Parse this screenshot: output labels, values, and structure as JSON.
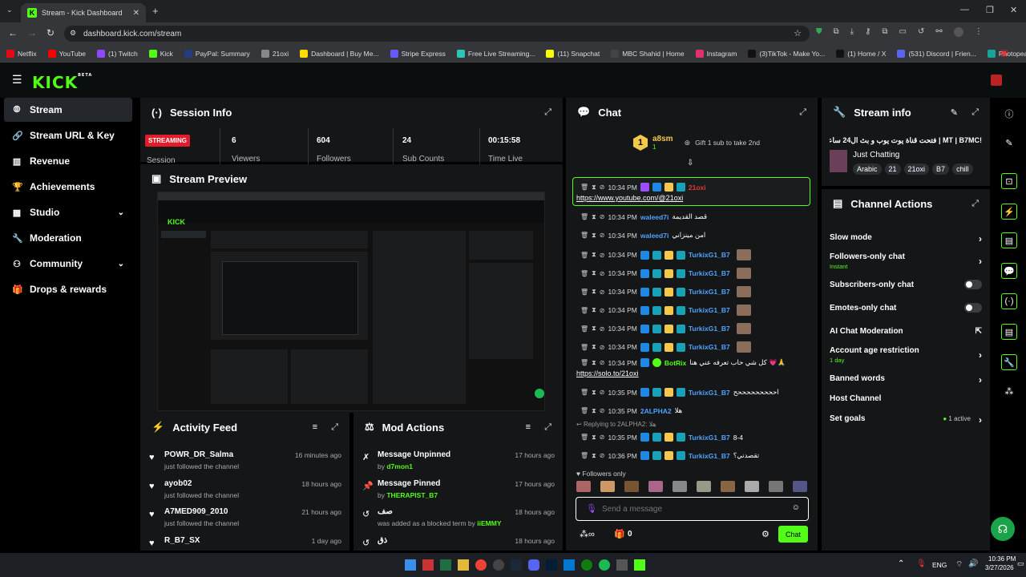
{
  "browser": {
    "tab_title": "Stream - Kick Dashboard",
    "url": "dashboard.kick.com/stream",
    "bookmarks": [
      {
        "label": "Netflix",
        "color": "#e50914"
      },
      {
        "label": "YouTube",
        "color": "#ff0000"
      },
      {
        "label": "(1) Twitch",
        "color": "#9146ff"
      },
      {
        "label": "Kick",
        "color": "#53fc18"
      },
      {
        "label": "PayPal: Summary",
        "color": "#253b80"
      },
      {
        "label": "21oxi",
        "color": "#888888"
      },
      {
        "label": "Dashboard | Buy Me...",
        "color": "#ffdd00"
      },
      {
        "label": "Stripe Express",
        "color": "#635bff"
      },
      {
        "label": "Free Live Streaming...",
        "color": "#2ec4b6"
      },
      {
        "label": "(11) Snapchat",
        "color": "#fffc00"
      },
      {
        "label": "MBC Shahid | Home",
        "color": "#444444"
      },
      {
        "label": "Instagram",
        "color": "#e1306c"
      },
      {
        "label": "(3)TikTok - Make Yo...",
        "color": "#111111"
      },
      {
        "label": "(1) Home / X",
        "color": "#111111"
      },
      {
        "label": "(531) Discord | Frien...",
        "color": "#5865f2"
      },
      {
        "label": "Photopea | Online P...",
        "color": "#18a497"
      }
    ]
  },
  "app": {
    "logo": "KICK",
    "logo_beta": "BETA"
  },
  "sidebar": {
    "items": [
      {
        "label": "Stream",
        "icon": "broadcast-icon"
      },
      {
        "label": "Stream URL & Key",
        "icon": "link-icon"
      },
      {
        "label": "Revenue",
        "icon": "chart-icon"
      },
      {
        "label": "Achievements",
        "icon": "trophy-icon"
      },
      {
        "label": "Studio",
        "icon": "grid-icon"
      },
      {
        "label": "Moderation",
        "icon": "wrench-icon"
      },
      {
        "label": "Community",
        "icon": "people-icon"
      },
      {
        "label": "Drops & rewards",
        "icon": "gift-icon"
      }
    ]
  },
  "session": {
    "title": "Session Info",
    "status": "STREAMING",
    "status_label": "Session",
    "viewers": "6",
    "viewers_label": "Viewers",
    "followers": "604",
    "followers_label": "Followers",
    "subs": "24",
    "subs_label": "Sub Counts",
    "time": "00:15:58",
    "time_label": "Time Live"
  },
  "preview": {
    "title": "Stream Preview"
  },
  "activity": {
    "title": "Activity Feed",
    "items": [
      {
        "name": "POWR_DR_Salma",
        "action": "just followed the channel",
        "time": "16 minutes ago"
      },
      {
        "name": "ayob02",
        "action": "just followed the channel",
        "time": "18 hours ago"
      },
      {
        "name": "A7MED909_2010",
        "action": "just followed the channel",
        "time": "21 hours ago"
      },
      {
        "name": "R_B7_SX",
        "action": "",
        "time": "1 day ago"
      }
    ]
  },
  "mod": {
    "title": "Mod Actions",
    "items": [
      {
        "name": "Message Unpinned",
        "pre": "by",
        "actor": "d7mon1",
        "post": "",
        "time": "17 hours ago"
      },
      {
        "name": "Message Pinned",
        "pre": "by",
        "actor": "THERAPIST_B7",
        "post": "",
        "time": "17 hours ago"
      },
      {
        "name": "صف",
        "pre": "was added as a blocked term by",
        "actor": "iiEMMY",
        "post": "",
        "time": "18 hours ago"
      },
      {
        "name": "ذق",
        "pre": "",
        "actor": "",
        "post": "",
        "time": "18 hours ago"
      }
    ]
  },
  "chat": {
    "title": "Chat",
    "gifter_name": "a8sm",
    "gifter_count": "1",
    "gift_prompt": "Gift 1 sub to take 2nd",
    "highlight": {
      "time": "10:34 PM",
      "user": "21oxi",
      "text": "https://www.youtube.com/@21oxi"
    },
    "messages": [
      {
        "time": "10:34 PM",
        "user": "waleed7i",
        "text": "قصد القديمة",
        "color": "#4fa3ff"
      },
      {
        "time": "10:34 PM",
        "user": "waleed7i",
        "text": "امن مينزاني",
        "color": "#4fa3ff"
      },
      {
        "time": "10:34 PM",
        "user": "TurkixG1_B7",
        "text": "",
        "color": "#4fa3ff"
      },
      {
        "time": "10:34 PM",
        "user": "TurkixG1_B7",
        "text": "",
        "color": "#4fa3ff"
      },
      {
        "time": "10:34 PM",
        "user": "TurkixG1_B7",
        "text": "",
        "color": "#4fa3ff"
      },
      {
        "time": "10:34 PM",
        "user": "TurkixG1_B7",
        "text": "",
        "color": "#4fa3ff"
      },
      {
        "time": "10:34 PM",
        "user": "TurkixG1_B7",
        "text": "",
        "color": "#4fa3ff"
      },
      {
        "time": "10:34 PM",
        "user": "TurkixG1_B7",
        "text": "",
        "color": "#4fa3ff"
      }
    ],
    "bot": {
      "time": "10:34 PM",
      "user": "BotRix",
      "text": "كل شي حاب تعرفه عني هنا 💗🙏",
      "link": "https://solo.to/21oxi"
    },
    "messages2": [
      {
        "time": "10:35 PM",
        "user": "TurkixG1_B7",
        "text": "احححححححححح",
        "color": "#4fa3ff"
      },
      {
        "time": "10:35 PM",
        "user": "2ALPHA2",
        "text": "هلا",
        "color": "#4fa3ff"
      }
    ],
    "reply_to": "Replying to 2ALPHA2: هلا",
    "messages3": [
      {
        "time": "10:35 PM",
        "user": "TurkixG1_B7",
        "text": "8-4",
        "color": "#4fa3ff"
      },
      {
        "time": "10:36 PM",
        "user": "TurkixG1_B7",
        "text": "تقصدني؟",
        "color": "#4fa3ff"
      }
    ],
    "followers_only": "Followers only",
    "placeholder": "Send a message",
    "points": "0",
    "send": "Chat"
  },
  "stream_info": {
    "title": "Stream info",
    "stream_title": "!MT | B7MC | فتحت قناة يوت يوب و بث ال24 ساعة",
    "category": "Just Chatting",
    "tags": [
      "Arabic",
      "21",
      "21oxi",
      "B7",
      "chill"
    ]
  },
  "channel_actions": {
    "title": "Channel Actions",
    "rows": [
      {
        "label": "Slow mode",
        "sub": "",
        "control": "chevron"
      },
      {
        "label": "Followers-only chat",
        "sub": "Instant",
        "control": "chevron"
      },
      {
        "label": "Subscribers-only chat",
        "sub": "",
        "control": "toggle"
      },
      {
        "label": "Emotes-only chat",
        "sub": "",
        "control": "toggle"
      },
      {
        "label": "AI Chat Moderation",
        "sub": "",
        "control": "external"
      },
      {
        "label": "Account age restriction",
        "sub": "1 day",
        "control": "chevron"
      },
      {
        "label": "Banned words",
        "sub": "",
        "control": "chevron"
      },
      {
        "label": "Host Channel",
        "sub": "",
        "control": "none"
      },
      {
        "label": "Set goals",
        "sub": "",
        "control": "chevron",
        "status": "1 active"
      }
    ]
  },
  "taskbar": {
    "lang": "ENG",
    "time": "10:36 PM",
    "date": "3/27/2026"
  }
}
